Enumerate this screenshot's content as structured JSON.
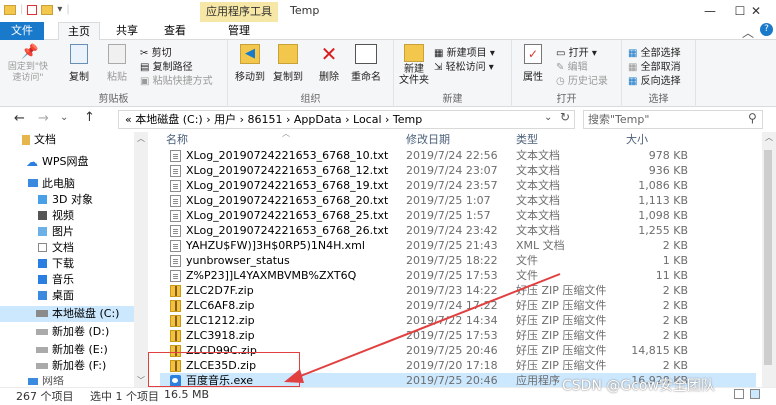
{
  "window": {
    "title": "Temp",
    "context_tab_group": "应用程序工具",
    "buttons": [
      "—",
      "☐",
      "✕"
    ]
  },
  "ribbon_tabs": [
    "文件",
    "主页",
    "共享",
    "查看",
    "管理"
  ],
  "ribbon": {
    "clipboard": {
      "label": "剪贴板",
      "pin": "固定到\"快速访问\"",
      "copy": "复制",
      "paste": "粘贴",
      "cut": "剪切",
      "copy_path": "复制路径",
      "paste_shortcut": "粘贴快捷方式"
    },
    "organize": {
      "label": "组织",
      "move_to": "移动到",
      "copy_to": "复制到",
      "delete": "删除",
      "rename": "重命名"
    },
    "new": {
      "label": "新建",
      "new_folder": "新建\n文件夹",
      "new_item": "新建项目 ▾",
      "easy_access": "轻松访问 ▾"
    },
    "open": {
      "label": "打开",
      "properties": "属性",
      "open": "打开 ▾",
      "edit": "编辑",
      "history": "历史记录"
    },
    "select": {
      "label": "选择",
      "select_all": "全部选择",
      "select_none": "全部取消",
      "invert": "反向选择"
    }
  },
  "address": {
    "path": "«  本地磁盘 (C:)  ›  用户  ›  86151  ›  AppData  ›  Local  ›  Temp",
    "search_placeholder": "搜索\"Temp\""
  },
  "nav_pane": [
    {
      "label": "文档"
    },
    {
      "label": "WPS网盘"
    },
    {
      "label": "此电脑"
    },
    {
      "label": "3D 对象"
    },
    {
      "label": "视频"
    },
    {
      "label": "图片"
    },
    {
      "label": "文档"
    },
    {
      "label": "下载"
    },
    {
      "label": "音乐"
    },
    {
      "label": "桌面"
    },
    {
      "label": "本地磁盘 (C:)"
    },
    {
      "label": "新加卷 (D:)"
    },
    {
      "label": "新加卷 (E:)"
    },
    {
      "label": "新加卷 (F:)"
    },
    {
      "label": "网络"
    }
  ],
  "columns": {
    "name": "名称",
    "date": "修改日期",
    "type": "类型",
    "size": "大小"
  },
  "files": [
    {
      "name": "XLog_20190724221653_6768_10.txt",
      "date": "2019/7/24 22:56",
      "type": "文本文档",
      "size": "978 KB",
      "icon": "text-file-icon"
    },
    {
      "name": "XLog_20190724221653_6768_12.txt",
      "date": "2019/7/24 23:07",
      "type": "文本文档",
      "size": "936 KB",
      "icon": "text-file-icon"
    },
    {
      "name": "XLog_20190724221653_6768_19.txt",
      "date": "2019/7/24 23:57",
      "type": "文本文档",
      "size": "1,086 KB",
      "icon": "text-file-icon"
    },
    {
      "name": "XLog_20190724221653_6768_20.txt",
      "date": "2019/7/25 1:07",
      "type": "文本文档",
      "size": "1,113 KB",
      "icon": "text-file-icon"
    },
    {
      "name": "XLog_20190724221653_6768_25.txt",
      "date": "2019/7/25 1:57",
      "type": "文本文档",
      "size": "1,098 KB",
      "icon": "text-file-icon"
    },
    {
      "name": "XLog_20190724221653_6768_26.txt",
      "date": "2019/7/24 23:42",
      "type": "文本文档",
      "size": "1,255 KB",
      "icon": "text-file-icon"
    },
    {
      "name": "YAHZU$FW)]3H$0RP5)1N4H.xml",
      "date": "2019/7/25 21:43",
      "type": "XML 文档",
      "size": "2 KB",
      "icon": "xml-file-icon"
    },
    {
      "name": "yunbrowser_status",
      "date": "2019/7/25 18:22",
      "type": "文件",
      "size": "1 KB",
      "icon": "blank-file-icon"
    },
    {
      "name": "Z%P23]]L4YAXMBVMB%ZXT6Q",
      "date": "2019/7/25 17:53",
      "type": "文件",
      "size": "11 KB",
      "icon": "blank-file-icon"
    },
    {
      "name": "ZLC2D7F.zip",
      "date": "2019/7/23 14:22",
      "type": "好压 ZIP 压缩文件",
      "size": "2 KB",
      "icon": "zip-file-icon"
    },
    {
      "name": "ZLC6AF8.zip",
      "date": "2019/7/24 17:22",
      "type": "好压 ZIP 压缩文件",
      "size": "2 KB",
      "icon": "zip-file-icon"
    },
    {
      "name": "ZLC1212.zip",
      "date": "2019/7/22 14:34",
      "type": "好压 ZIP 压缩文件",
      "size": "2 KB",
      "icon": "zip-file-icon"
    },
    {
      "name": "ZLC3918.zip",
      "date": "2019/7/25 17:53",
      "type": "好压 ZIP 压缩文件",
      "size": "2 KB",
      "icon": "zip-file-icon"
    },
    {
      "name": "ZLCD99C.zip",
      "date": "2019/7/25 20:46",
      "type": "好压 ZIP 压缩文件",
      "size": "14,815 KB",
      "icon": "zip-file-icon"
    },
    {
      "name": "ZLCE35D.zip",
      "date": "2019/7/20 17:18",
      "type": "好压 ZIP 压缩文件",
      "size": "2 KB",
      "icon": "zip-file-icon"
    },
    {
      "name": "百度音乐.exe",
      "date": "2019/7/25 20:46",
      "type": "应用程序",
      "size": "16,928 KB",
      "icon": "exe-file-icon"
    }
  ],
  "status": {
    "count": "267 个项目",
    "selected": "选中 1 个项目",
    "size": "16.5 MB"
  },
  "watermark": "CSDN @Gcow安全团队",
  "colors": {
    "accent": "#1979ca",
    "selection": "#cce8ff",
    "annotation": "#e24040"
  }
}
